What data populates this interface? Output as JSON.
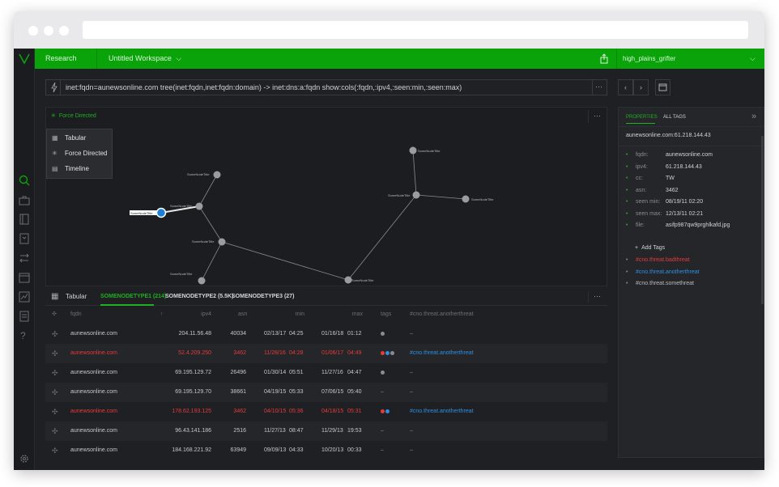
{
  "app": {
    "nav_label": "Research",
    "workspace": "Untitled Workspace",
    "user": "high_plains_grifter"
  },
  "query": {
    "text": "inet:fqdn=aunewsonline.com tree(inet:fqdn,inet:fqdn:domain) -> inet:dns:a:fqdn show:cols(:fqdn,:ipv4,:seen:min,:seen:max)",
    "more": "···"
  },
  "graph": {
    "view_label": "Force Directed",
    "more": "···",
    "view_menu": [
      {
        "label": "Tabular",
        "icon": "table-icon"
      },
      {
        "label": "Force Directed",
        "icon": "force-directed-icon"
      },
      {
        "label": "Timeline",
        "icon": "timeline-icon"
      }
    ],
    "node_label": "SomeNodeTitle"
  },
  "grid": {
    "view_label": "Tabular",
    "tabs": [
      "SOMENODETYPE1 (214)",
      "SOMENODETYPE2 (5.5K)",
      "SOMENODETYPE3 (27)"
    ],
    "more": "···",
    "columns": [
      "fqdn",
      "ipv4",
      "asn",
      "min",
      "max",
      "tags",
      "#cno.threat.anotherthreat"
    ],
    "sort_arrow": "↑",
    "rows": [
      {
        "fqdn": "aunewsonline.com",
        "ipv4": "204.11.56.48",
        "asn": "40034",
        "min_date": "02/13/17",
        "min_time": "04:25",
        "max_date": "01/16/18",
        "max_time": "01:12",
        "tag_colors": [
          "#8a8c91"
        ],
        "tag": "–",
        "hot": false
      },
      {
        "fqdn": "aunewsonline.com",
        "ipv4": "52.4.209.250",
        "asn": "3462",
        "min_date": "11/28/16",
        "min_time": "04:28",
        "max_date": "01/06/17",
        "max_time": "04:49",
        "tag_colors": [
          "#e53b3b",
          "#2f8fe0",
          "#8a8c91"
        ],
        "tag": "#cno.threat.anotherthreat",
        "hot": true
      },
      {
        "fqdn": "aunewsonline.com",
        "ipv4": "69.195.129.72",
        "asn": "26496",
        "min_date": "01/30/14",
        "min_time": "05:51",
        "max_date": "11/27/16",
        "max_time": "04:47",
        "tag_colors": [
          "#8a8c91"
        ],
        "tag": "–",
        "hot": false
      },
      {
        "fqdn": "aunewsonline.com",
        "ipv4": "69.195.129.70",
        "asn": "38661",
        "min_date": "04/19/15",
        "min_time": "05:33",
        "max_date": "07/06/15",
        "max_time": "05:40",
        "tag_colors": [],
        "tag": "–",
        "hot": false
      },
      {
        "fqdn": "aunewsonline.com",
        "ipv4": "178.62.193.125",
        "asn": "3462",
        "min_date": "04/10/15",
        "min_time": "05:36",
        "max_date": "04/18/15",
        "max_time": "05:31",
        "tag_colors": [
          "#e53b3b",
          "#2f8fe0"
        ],
        "tag": "#cno.threat.anotherthreat",
        "hot": true
      },
      {
        "fqdn": "aunewsonline.com",
        "ipv4": "96.43.141.186",
        "asn": "2516",
        "min_date": "11/27/13",
        "min_time": "08:47",
        "max_date": "11/29/13",
        "max_time": "19:53",
        "tag_colors": [],
        "tag": "–",
        "hot": false
      },
      {
        "fqdn": "aunewsonline.com",
        "ipv4": "184.168.221.92",
        "asn": "63949",
        "min_date": "09/09/13",
        "min_time": "04:33",
        "max_date": "10/20/13",
        "max_time": "00:33",
        "tag_colors": [],
        "tag": "–",
        "hot": false
      }
    ]
  },
  "properties": {
    "tab_properties": "PROPERTIES",
    "tab_tags": "ALL TAGS",
    "node_title": "aunewsonline.com:61.218.144.43",
    "fields": [
      {
        "key": "fqdn:",
        "value": "aunewsonline.com"
      },
      {
        "key": "ipv4:",
        "value": "61.218.144.43"
      },
      {
        "key": "cc:",
        "value": "TW"
      },
      {
        "key": "asn:",
        "value": "3462"
      },
      {
        "key": "seen min:",
        "value": "08/19/11  02:20"
      },
      {
        "key": "seen max:",
        "value": "12/13/11  02:21"
      },
      {
        "key": "file:",
        "value": "asifp987qw9prghlkafd.jpg"
      }
    ],
    "add_tags": "Add Tags",
    "tags": [
      {
        "label": "#cno.threat.badthreat",
        "color": "#e53b3b"
      },
      {
        "label": "#cno.threat.anotherthreat",
        "color": "#2f8fe0"
      },
      {
        "label": "#cno.threat.somethreat",
        "color": "#b8babf"
      }
    ]
  },
  "colors": {
    "accent": "#0aa40a",
    "threat": "#e53b3b",
    "info": "#2f8fe0"
  }
}
